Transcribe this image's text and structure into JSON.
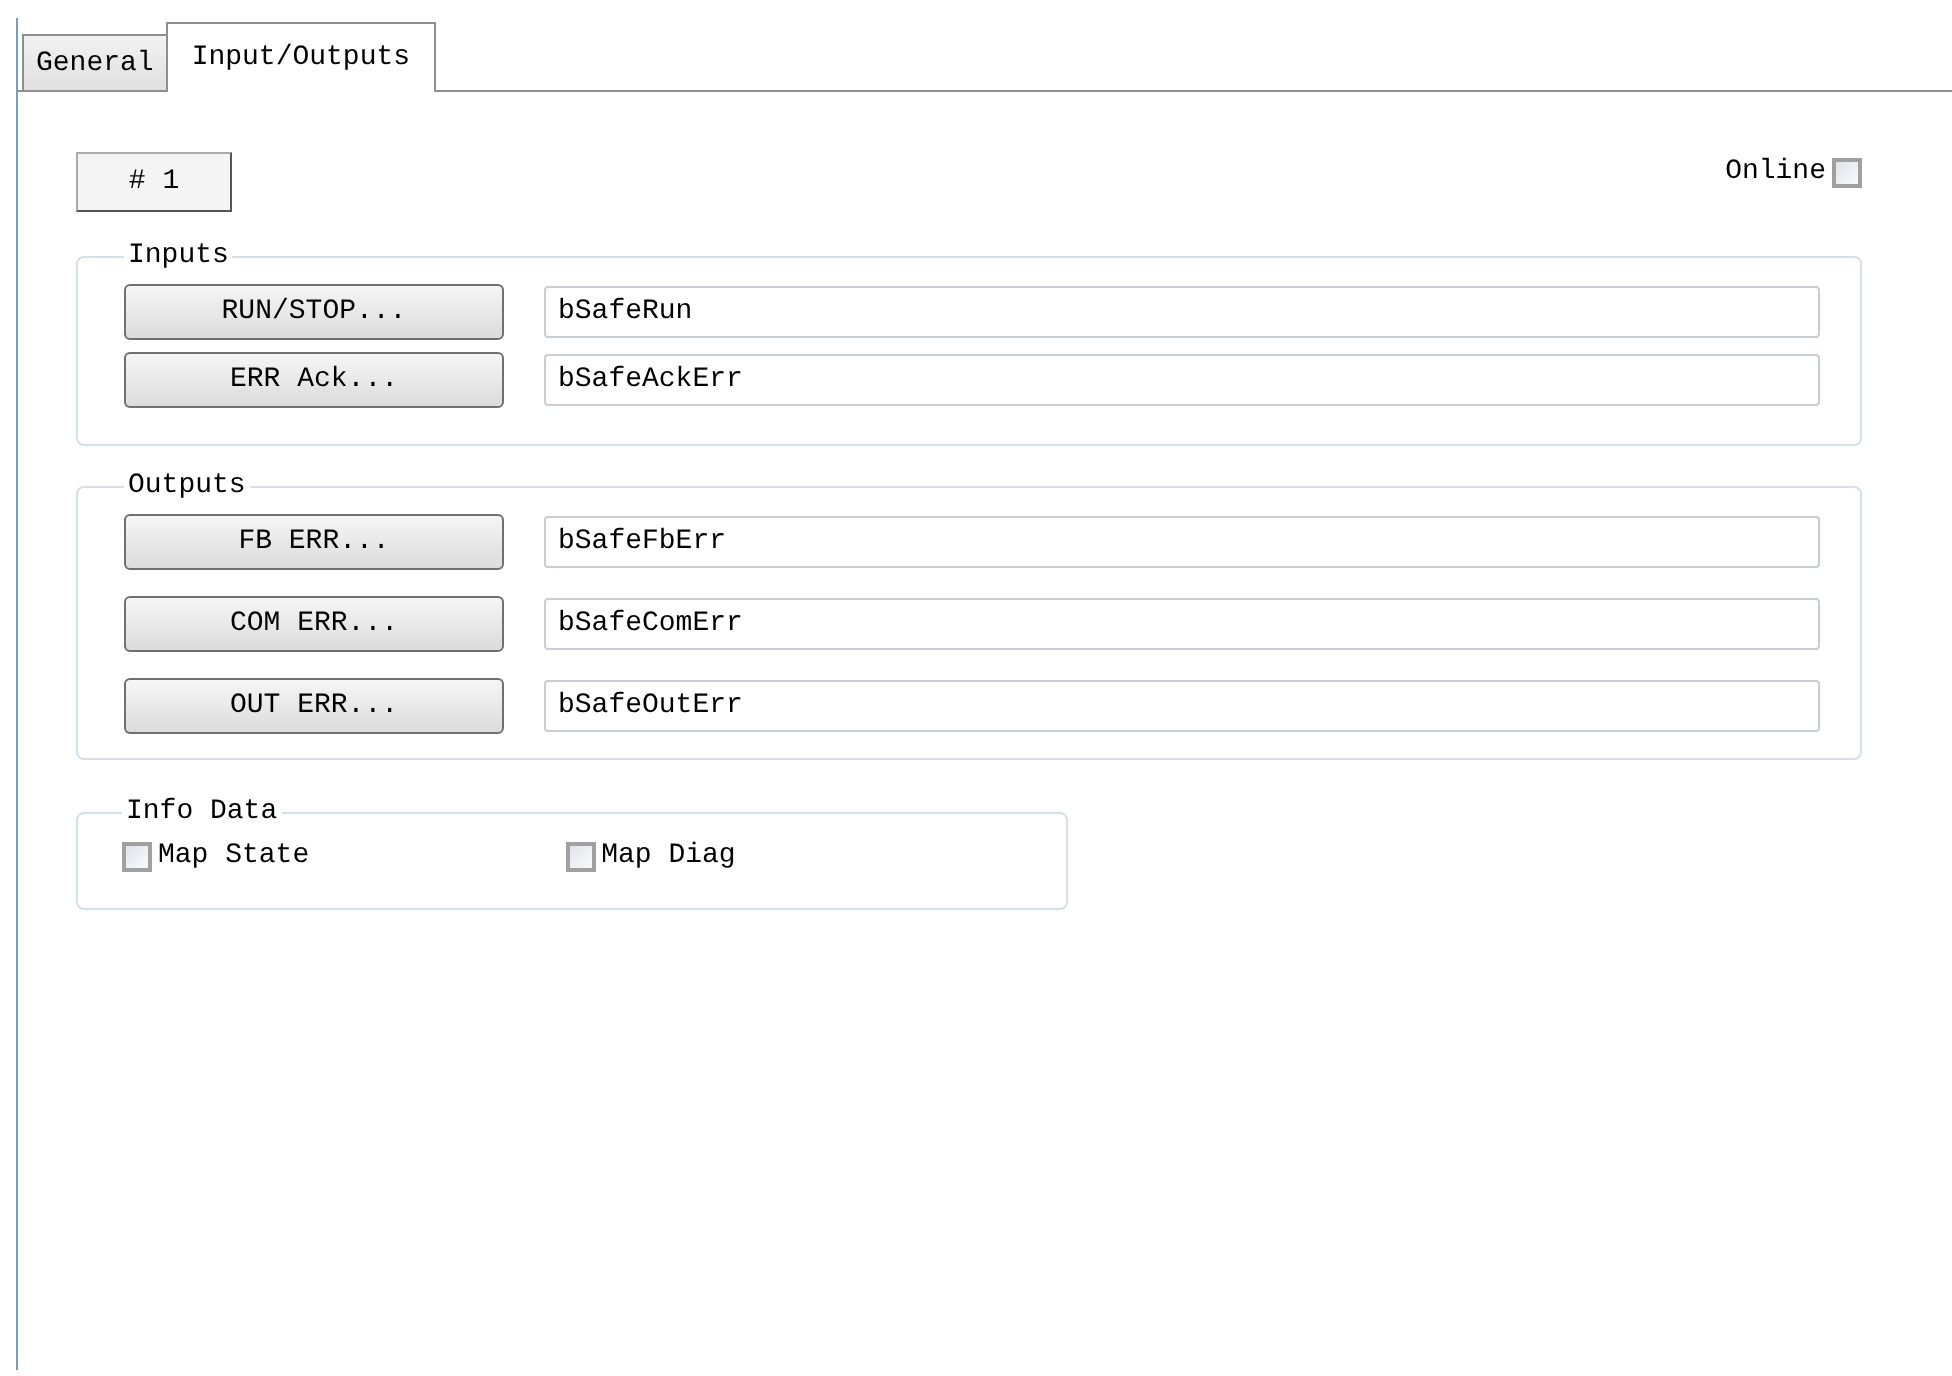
{
  "tabs": [
    {
      "label": "General",
      "selected": false
    },
    {
      "label": "Input/Outputs",
      "selected": true
    }
  ],
  "instance_button": "# 1",
  "online": {
    "label": "Online",
    "checked": false
  },
  "groups": [
    {
      "title": "Inputs",
      "rows": [
        {
          "button": "RUN/STOP...",
          "value": "bSafeRun"
        },
        {
          "button": "ERR Ack...",
          "value": "bSafeAckErr"
        }
      ]
    },
    {
      "title": "Outputs",
      "rows": [
        {
          "button": "FB ERR...",
          "value": "bSafeFbErr"
        },
        {
          "button": "COM ERR...",
          "value": "bSafeComErr"
        },
        {
          "button": "OUT ERR...",
          "value": "bSafeOutErr"
        }
      ]
    }
  ],
  "info_data": {
    "title": "Info Data",
    "options": [
      {
        "label": "Map State",
        "checked": false
      },
      {
        "label": "Map Diag",
        "checked": false
      }
    ]
  }
}
